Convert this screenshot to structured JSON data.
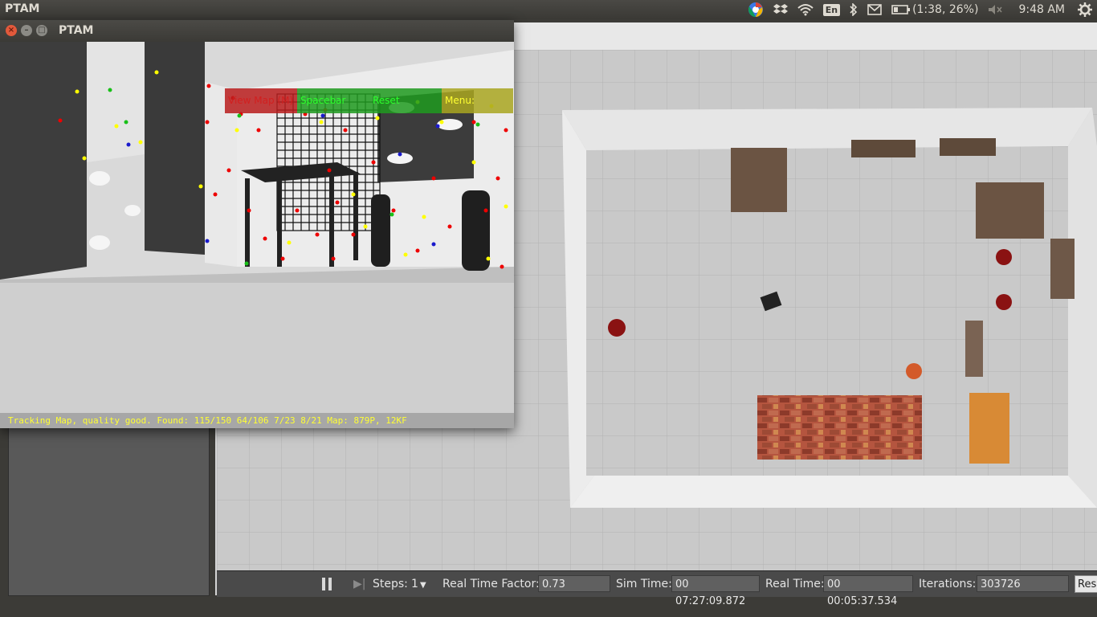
{
  "topbar": {
    "app_title": "PTAM",
    "battery_text": "(1:38, 26%)",
    "keyboard_layout": "En",
    "clock": "9:48 AM",
    "icons": [
      "chrome-icon",
      "dropbox-icon",
      "wifi-icon",
      "keyboard-icon",
      "bluetooth-icon",
      "mail-icon",
      "battery-icon",
      "volume-muted-icon",
      "gear-icon"
    ]
  },
  "ptam": {
    "window_title": "PTAM",
    "menu": {
      "view_map": "View Map (M)",
      "spacebar": "Spacebar",
      "reset": "Reset",
      "menu": "Menu:"
    },
    "status": "Tracking Map, quality good. Found: 115/150 64/106 7/23 8/21 Map: 879P, 12KF"
  },
  "gazebo": {
    "steps_label": "Steps:",
    "steps_value": "1",
    "rtf_label": "Real Time Factor:",
    "rtf_value": "0.73",
    "sim_time_label": "Sim Time:",
    "sim_time_value": "00 07:27:09.872",
    "real_time_label": "Real Time:",
    "real_time_value": "00 00:05:37.534",
    "iterations_label": "Iterations:",
    "iterations_value": "303726",
    "reset_label": "Res"
  },
  "colors": {
    "menu_red": "#b81c1c",
    "menu_green": "#1e9a1e",
    "menu_yellow": "#a9a620",
    "status_text": "#ffff33"
  }
}
